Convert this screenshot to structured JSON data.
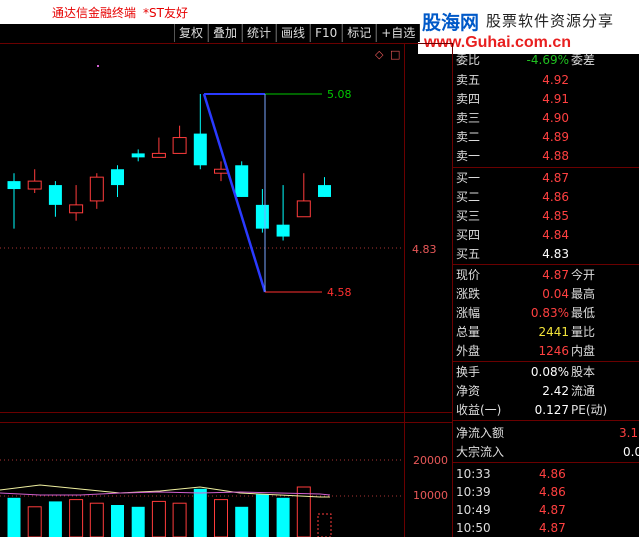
{
  "app": {
    "title": "通达信金融终端",
    "stock": "*ST友好"
  },
  "watermark": {
    "logo": "股海网",
    "slogan": "股票软件资源分享",
    "url": "www.Guhai.com.cn"
  },
  "toolbar": {
    "items": [
      "复权",
      "叠加",
      "统计",
      "画线",
      "F10",
      "标记",
      "+自选"
    ]
  },
  "chart": {
    "current_price_label": "4.83",
    "annotation_high": "5.08",
    "annotation_low": "4.58",
    "volume_axis": [
      "20000",
      "10000"
    ],
    "candles": [
      {
        "o": 4.86,
        "c": 4.84,
        "h": 4.88,
        "l": 4.74
      },
      {
        "o": 4.84,
        "c": 4.86,
        "h": 4.89,
        "l": 4.83
      },
      {
        "o": 4.85,
        "c": 4.8,
        "h": 4.86,
        "l": 4.77
      },
      {
        "o": 4.78,
        "c": 4.8,
        "h": 4.85,
        "l": 4.76
      },
      {
        "o": 4.81,
        "c": 4.87,
        "h": 4.88,
        "l": 4.79
      },
      {
        "o": 4.89,
        "c": 4.85,
        "h": 4.9,
        "l": 4.82
      },
      {
        "o": 4.93,
        "c": 4.92,
        "h": 4.94,
        "l": 4.91
      },
      {
        "o": 4.92,
        "c": 4.93,
        "h": 4.97,
        "l": 4.92
      },
      {
        "o": 4.93,
        "c": 4.97,
        "h": 5.0,
        "l": 4.93
      },
      {
        "o": 4.98,
        "c": 4.9,
        "h": 5.08,
        "l": 4.89
      },
      {
        "o": 4.88,
        "c": 4.89,
        "h": 4.91,
        "l": 4.86
      },
      {
        "o": 4.9,
        "c": 4.82,
        "h": 4.91,
        "l": 4.82
      },
      {
        "o": 4.8,
        "c": 4.74,
        "h": 4.84,
        "l": 4.73
      },
      {
        "o": 4.75,
        "c": 4.72,
        "h": 4.85,
        "l": 4.71
      },
      {
        "o": 4.77,
        "c": 4.81,
        "h": 4.88,
        "l": 4.77
      },
      {
        "o": 4.85,
        "c": 4.82,
        "h": 4.87,
        "l": 4.82
      }
    ],
    "volumes": [
      9500,
      7000,
      8500,
      9000,
      8000,
      7500,
      7000,
      8500,
      8000,
      12000,
      9000,
      7000,
      10500,
      9500,
      12500,
      5000
    ],
    "colors": {
      "up": "#ff3c3c",
      "down": "#00ffff",
      "trend": "#2a3aff",
      "high_line": "#00c800",
      "low_line": "#ff3030",
      "vertical": "#7aa6ff"
    }
  },
  "quote": {
    "header": {
      "label": "委比",
      "value": "-4.69%",
      "label2": "委差"
    },
    "asks": [
      {
        "label": "卖五",
        "price": "4.92"
      },
      {
        "label": "卖四",
        "price": "4.91"
      },
      {
        "label": "卖三",
        "price": "4.90"
      },
      {
        "label": "卖二",
        "price": "4.89"
      },
      {
        "label": "卖一",
        "price": "4.88"
      }
    ],
    "bids": [
      {
        "label": "买一",
        "price": "4.87"
      },
      {
        "label": "买二",
        "price": "4.86"
      },
      {
        "label": "买三",
        "price": "4.85"
      },
      {
        "label": "买四",
        "price": "4.84"
      },
      {
        "label": "买五",
        "price": "4.83"
      }
    ],
    "stats": [
      {
        "label": "现价",
        "value": "4.87",
        "label2": "今开",
        "color": "red"
      },
      {
        "label": "涨跌",
        "value": "0.04",
        "label2": "最高",
        "color": "red"
      },
      {
        "label": "涨幅",
        "value": "0.83%",
        "label2": "最低",
        "color": "red"
      },
      {
        "label": "总量",
        "value": "2441",
        "label2": "量比",
        "color": "yel"
      },
      {
        "label": "外盘",
        "value": "1246",
        "label2": "内盘",
        "color": "red"
      }
    ],
    "fundamentals": [
      {
        "label": "换手",
        "value": "0.08%",
        "label2": "股本"
      },
      {
        "label": "净资",
        "value": "2.42",
        "label2": "流通"
      },
      {
        "label": "收益(一)",
        "value": "0.127",
        "label2": "PE(动)"
      }
    ],
    "flows": [
      {
        "label": "净流入额",
        "value": "3.1"
      },
      {
        "label": "大宗流入",
        "value": "0.0"
      }
    ],
    "ticks": [
      {
        "time": "10:33",
        "price": "4.86"
      },
      {
        "time": "10:39",
        "price": "4.86"
      },
      {
        "time": "10:49",
        "price": "4.87"
      },
      {
        "time": "10:50",
        "price": "4.87"
      }
    ]
  }
}
